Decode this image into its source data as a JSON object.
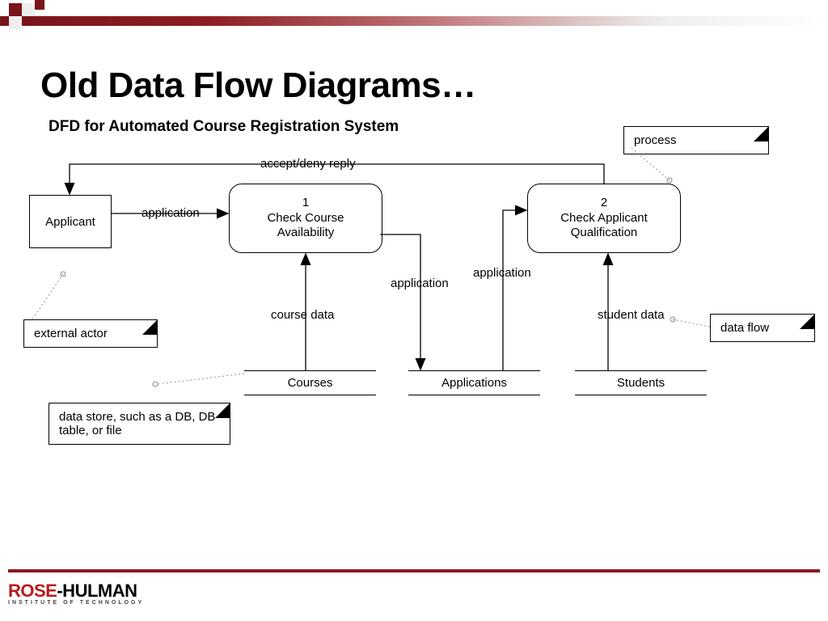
{
  "slide": {
    "title": "Old Data Flow Diagrams…",
    "subtitle": "DFD for Automated Course Registration System"
  },
  "nodes": {
    "applicant": "Applicant",
    "p1_num": "1",
    "p1_name": "Check Course\nAvailability",
    "p2_num": "2",
    "p2_name": "Check Applicant\nQualification",
    "courses": "Courses",
    "applications": "Applications",
    "students": "Students"
  },
  "flows": {
    "application1": "application",
    "application2": "application",
    "application3": "application",
    "course_data": "course data",
    "student_data": "student data",
    "accept_deny": "accept/deny reply"
  },
  "legend": {
    "external_actor": "external actor",
    "process": "process",
    "data_store": "data store, such as a DB, DB table, or file",
    "data_flow": "data flow"
  },
  "brand": {
    "rose": "ROSE",
    "hulman": "-HULMAN",
    "tagline": "INSTITUTE OF TECHNOLOGY"
  }
}
